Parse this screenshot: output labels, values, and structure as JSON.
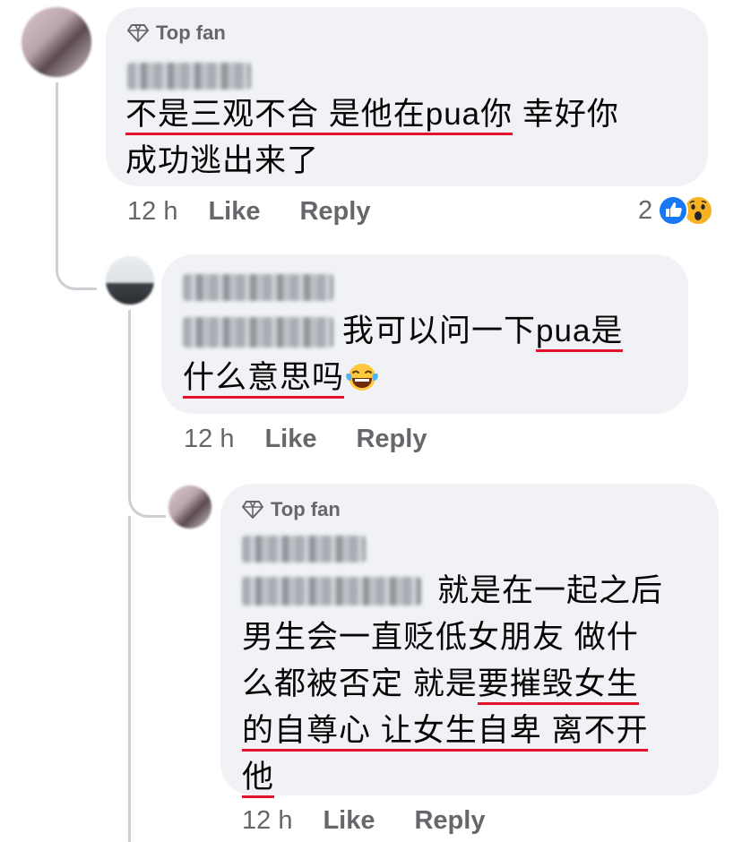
{
  "comments": [
    {
      "badge": "Top fan",
      "lines": [
        [
          {
            "t": "不是三观不合 是他在pua你",
            "u": true
          },
          {
            "t": " 幸好你",
            "u": false
          }
        ],
        [
          {
            "t": "成功逃出来了",
            "u": false
          }
        ]
      ],
      "time": "12 h",
      "like_label": "Like",
      "reply_label": "Reply",
      "reaction_count": "2",
      "reactions": [
        "like-reaction",
        "wow-reaction"
      ]
    },
    {
      "lines": [
        [
          {
            "t": "我可以问一下",
            "u": false
          },
          {
            "t": "pua是",
            "u": true
          }
        ],
        [
          {
            "t": "什么意思吗",
            "u": true
          }
        ]
      ],
      "emoji": "tears-of-joy-emoji",
      "time": "12 h",
      "like_label": "Like",
      "reply_label": "Reply"
    },
    {
      "badge": "Top fan",
      "lines": [
        [
          {
            "t": "就是在一起之后",
            "u": false
          }
        ],
        [
          {
            "t": "男生会一直贬低女朋友 做什",
            "u": false
          }
        ],
        [
          {
            "t": "么都被否定 就是",
            "u": false
          },
          {
            "t": "要摧毁女生",
            "u": true
          }
        ],
        [
          {
            "t": "的自尊心 让女生自卑 离不开",
            "u": true
          }
        ],
        [
          {
            "t": "他",
            "u": true
          }
        ]
      ],
      "time": "12 h",
      "like_label": "Like",
      "reply_label": "Reply"
    }
  ],
  "colors": {
    "bubble": "#f0f2f5",
    "meta": "#65676b",
    "underline": "#e4112c",
    "like_blue": "#1877f2",
    "wow_yellow": "#f7b125"
  }
}
